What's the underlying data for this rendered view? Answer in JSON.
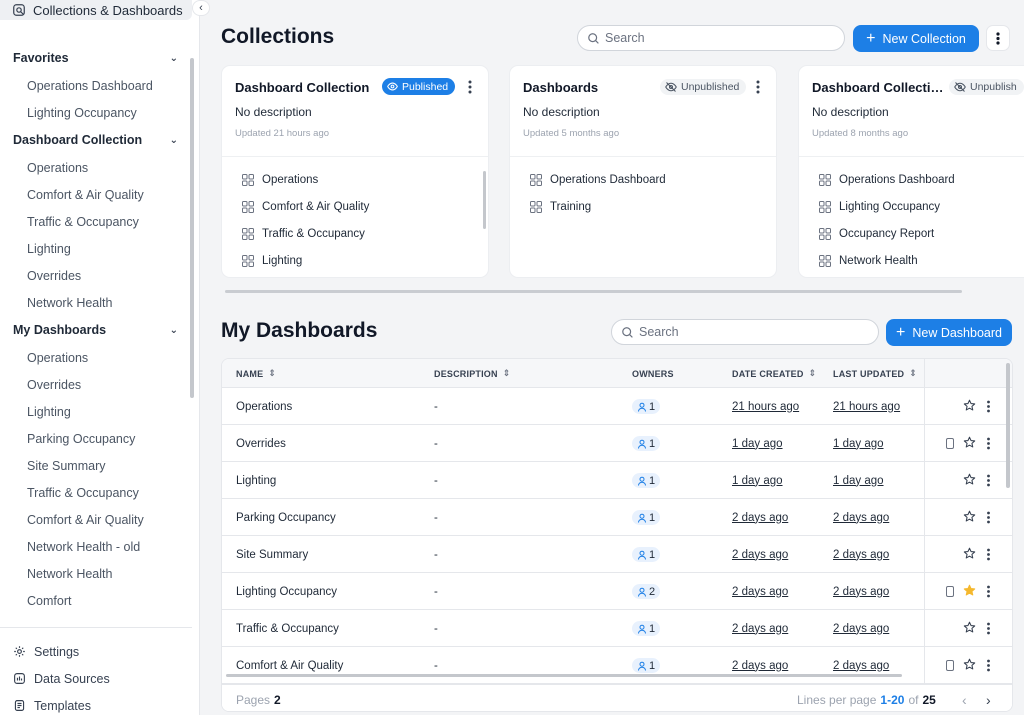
{
  "app": {
    "title": "Collections & Dashboards"
  },
  "sidebar": {
    "favorites": {
      "title": "Favorites",
      "items": [
        "Operations Dashboard",
        "Lighting Occupancy"
      ]
    },
    "dashboard_collection": {
      "title": "Dashboard Collection",
      "items": [
        "Operations",
        "Comfort & Air Quality",
        "Traffic & Occupancy",
        "Lighting",
        "Overrides",
        "Network Health"
      ]
    },
    "my_dashboards": {
      "title": "My Dashboards",
      "items": [
        "Operations",
        "Overrides",
        "Lighting",
        "Parking Occupancy",
        "Site Summary",
        "Traffic & Occupancy",
        "Comfort & Air Quality",
        "Network Health - old",
        "Network Health",
        "Comfort"
      ]
    },
    "bottom": [
      "Settings",
      "Data Sources",
      "Templates"
    ]
  },
  "collections": {
    "title": "Collections",
    "search_placeholder": "Search",
    "new_button": "New Collection",
    "cards": [
      {
        "title": "Dashboard Collection",
        "status": "Published",
        "description": "No description",
        "updated": "Updated 21 hours ago",
        "items": [
          "Operations",
          "Comfort & Air Quality",
          "Traffic & Occupancy",
          "Lighting"
        ]
      },
      {
        "title": "Dashboards",
        "status": "Unpublished",
        "description": "No description",
        "updated": "Updated 5 months ago",
        "items": [
          "Operations Dashboard",
          "Training"
        ]
      },
      {
        "title": "Dashboard Collecti…",
        "status": "Unpublish",
        "description": "No description",
        "updated": "Updated 8 months ago",
        "items": [
          "Operations Dashboard",
          "Lighting Occupancy",
          "Occupancy Report",
          "Network Health"
        ]
      }
    ]
  },
  "dashboards": {
    "title": "My Dashboards",
    "search_placeholder": "Search",
    "new_button": "New Dashboard",
    "columns": {
      "name": "NAME",
      "description": "DESCRIPTION",
      "owners": "OWNERS",
      "created": "DATE CREATED",
      "updated": "LAST UPDATED"
    },
    "rows": [
      {
        "name": "Operations",
        "description": "-",
        "owners": "1",
        "created": "21 hours ago",
        "updated": "21 hours ago",
        "device": false,
        "favorite": false
      },
      {
        "name": "Overrides",
        "description": "-",
        "owners": "1",
        "created": "1 day ago",
        "updated": "1 day ago",
        "device": true,
        "favorite": false
      },
      {
        "name": "Lighting",
        "description": "-",
        "owners": "1",
        "created": "1 day ago",
        "updated": "1 day ago",
        "device": false,
        "favorite": false
      },
      {
        "name": "Parking Occupancy",
        "description": "-",
        "owners": "1",
        "created": "2 days ago",
        "updated": "2 days ago",
        "device": false,
        "favorite": false
      },
      {
        "name": "Site Summary",
        "description": "-",
        "owners": "1",
        "created": "2 days ago",
        "updated": "2 days ago",
        "device": false,
        "favorite": false
      },
      {
        "name": "Lighting Occupancy",
        "description": "-",
        "owners": "2",
        "created": "2 days ago",
        "updated": "2 days ago",
        "device": true,
        "favorite": true
      },
      {
        "name": "Traffic & Occupancy",
        "description": "-",
        "owners": "1",
        "created": "2 days ago",
        "updated": "2 days ago",
        "device": false,
        "favorite": false
      },
      {
        "name": "Comfort & Air Quality",
        "description": "-",
        "owners": "1",
        "created": "2 days ago",
        "updated": "2 days ago",
        "device": true,
        "favorite": false
      }
    ],
    "footer": {
      "pages_label": "Pages",
      "pages_value": "2",
      "lines_label": "Lines per page",
      "range": "1-20",
      "of_label": "of",
      "total": "25"
    }
  },
  "colors": {
    "accent": "#1d7fe6",
    "favorite": "#f5b82e"
  }
}
